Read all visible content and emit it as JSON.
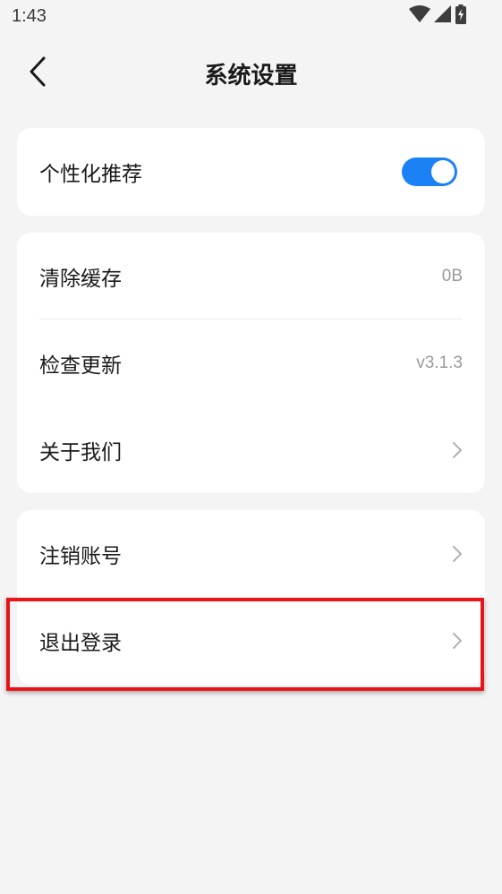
{
  "status_bar": {
    "time": "1:43",
    "icons": [
      "wifi-icon",
      "signal-icon",
      "battery-charging-icon"
    ]
  },
  "header": {
    "title": "系统设置",
    "back_icon": "chevron-left-icon"
  },
  "groups": [
    {
      "items": [
        {
          "label": "个性化推荐",
          "control": "toggle",
          "toggle_on": true,
          "toggle_color": "#1a82f5"
        }
      ]
    },
    {
      "items": [
        {
          "label": "清除缓存",
          "value": "0B"
        },
        {
          "label": "检查更新",
          "value": "v3.1.3"
        },
        {
          "label": "关于我们",
          "control": "chevron-right-icon"
        }
      ]
    },
    {
      "items": [
        {
          "label": "注销账号",
          "control": "chevron-right-icon"
        },
        {
          "label": "退出登录",
          "control": "chevron-right-icon",
          "highlighted": true
        }
      ]
    }
  ],
  "colors": {
    "background": "#f4f4f4",
    "card": "#ffffff",
    "accent": "#1a82f5",
    "highlight": "#e8141a",
    "secondary_text": "#9a9a9a"
  }
}
